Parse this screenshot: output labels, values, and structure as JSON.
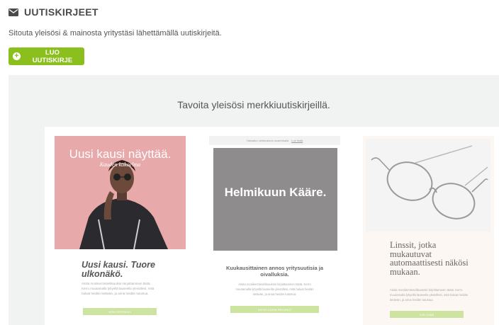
{
  "header": {
    "title": "UUTISKIRJEET",
    "icon": "envelope-icon"
  },
  "intro_text": "Sitouta yleisösi & mainosta yritystäsi lähettämällä uutiskirjeitä.",
  "create_button": {
    "label": "LUO UUTISKIRJE",
    "icon": "plus-circle-icon",
    "color": "#8bbf1e"
  },
  "showcase": {
    "heading": "Tavoita yleisösi merkkiuutiskirjeillä.",
    "cards": [
      {
        "hero_title": "Uusi kausi näyttää.",
        "hero_subtitle": "Kauden kokoelma",
        "heading": "Uusi kausi. Tuore ulkonäkö.",
        "body": "Aloita monikerroksellisuuksin kirjoittaminen tästä. Kerro muutamalla lyhyellä lauseella yleisöllesi, mitä haluat heidän tietävän, ja anna heidän tutustua.",
        "button": "HOW SPESIKÄYI"
      },
      {
        "topbar_text": "Haluatko verkkosivun uusimmalla",
        "topbar_link": "Lue lisää",
        "hero_title": "Helmikuun Kääre.",
        "heading": "Kuukausittainen annos yritysuutisia ja oivalluksia.",
        "body": "Aloita monikerroksellisuuksin kirjoittaminen tästä. Kerro muutamalla lyhyellä lauseella yleisöllesi, mitä haluat heidän tietävän, ja anna heidän tutustua.",
        "button": "KATSO UUSIN PROJEKTI"
      },
      {
        "heading": "Linssit, jotka mukautuvat automaattisesti näkösi mukaan.",
        "body": "Aloita monikerroksellisuuksin kirjoittaminen tästä. Kerro muutamalla lyhyellä lauseella yleisöllesi, mitä haluat heidän tietävän, ja anna heidän tutustua.",
        "button": "LUE LISÄÄ"
      }
    ]
  }
}
